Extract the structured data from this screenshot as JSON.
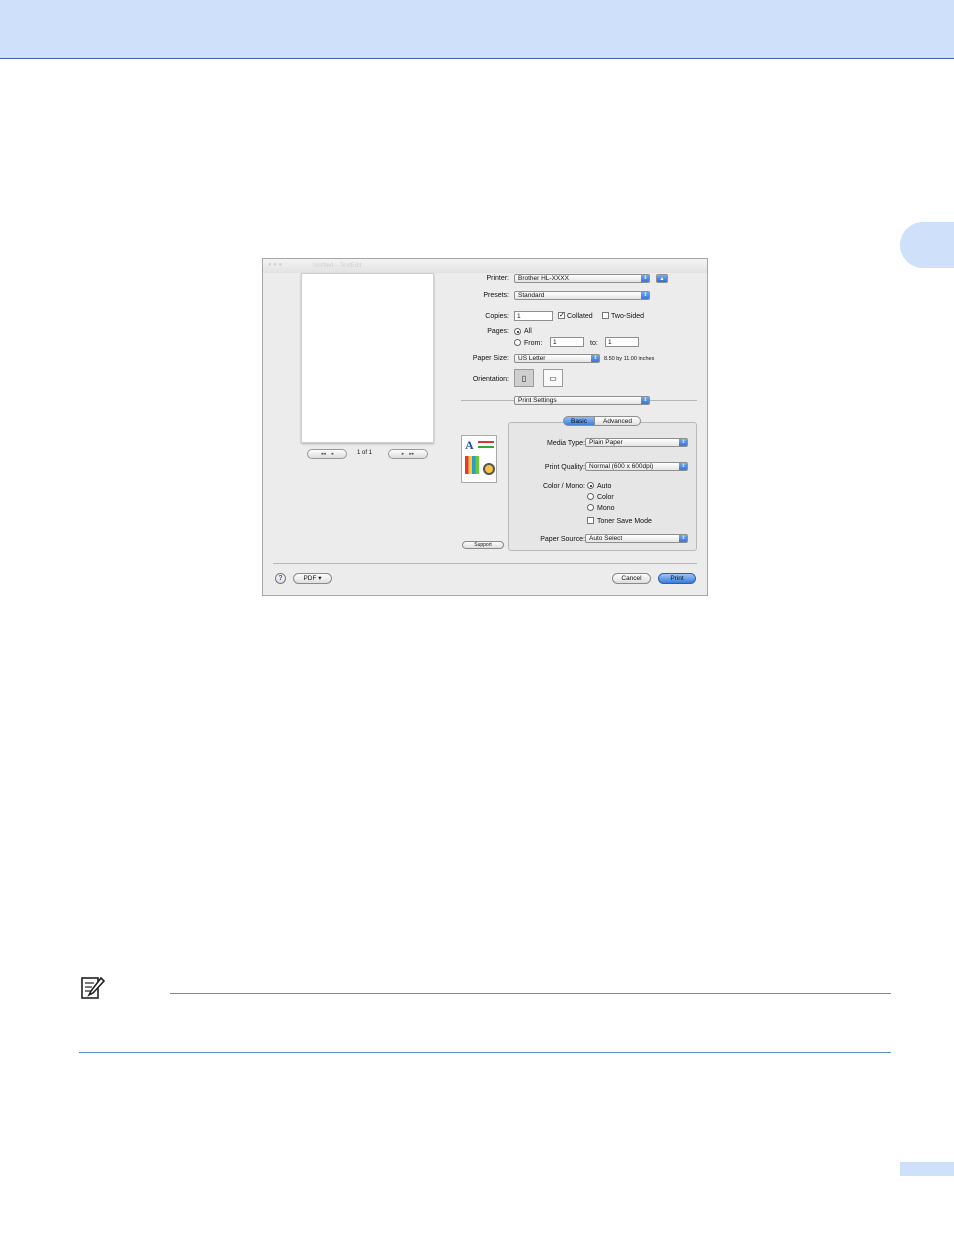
{
  "dialog": {
    "titlebar_ghost": "Untitled – TextEdit",
    "preview": {
      "page_indicator": "1 of 1",
      "first_label": "◂◂",
      "prev_label": "◂",
      "next_label": "▸",
      "last_label": "▸▸"
    },
    "printer": {
      "label": "Printer:",
      "value": "Brother HL-XXXX",
      "collapse_glyph": "▲"
    },
    "presets": {
      "label": "Presets:",
      "value": "Standard"
    },
    "copies": {
      "label": "Copies:",
      "value": "1",
      "collated_label": "Collated",
      "collated_checked": true,
      "two_sided_label": "Two-Sided",
      "two_sided_checked": false
    },
    "pages": {
      "label": "Pages:",
      "all_label": "All",
      "from_label": "From:",
      "from_value": "1",
      "to_label": "to:",
      "to_value": "1"
    },
    "paper_size": {
      "label": "Paper Size:",
      "value": "US Letter",
      "dimensions": "8.50 by 11.00 inches"
    },
    "orientation": {
      "label": "Orientation:"
    },
    "panel": {
      "value": "Print Settings"
    },
    "tabs": [
      {
        "label": "Basic",
        "selected": true
      },
      {
        "label": "Advanced",
        "selected": false
      }
    ],
    "media_type": {
      "label": "Media Type:",
      "value": "Plain Paper"
    },
    "print_quality": {
      "label": "Print Quality:",
      "value": "Normal (600 x 600dpi)"
    },
    "color_mono": {
      "label": "Color / Mono:",
      "options": [
        "Auto",
        "Color",
        "Mono"
      ],
      "selected": "Auto"
    },
    "toner_save": {
      "label": "Toner Save Mode",
      "checked": false
    },
    "paper_source": {
      "label": "Paper Source:",
      "value": "Auto Select"
    },
    "support_button": "Support",
    "help_glyph": "?",
    "pdf_button": "PDF ▾",
    "cancel_button": "Cancel",
    "print_button": "Print",
    "colors": {
      "accent": "#3b7bd9",
      "chrome": "#ececec"
    }
  },
  "page": {
    "colors": {
      "band": "#cfe0fb",
      "rule": "#5b8fd6"
    }
  }
}
